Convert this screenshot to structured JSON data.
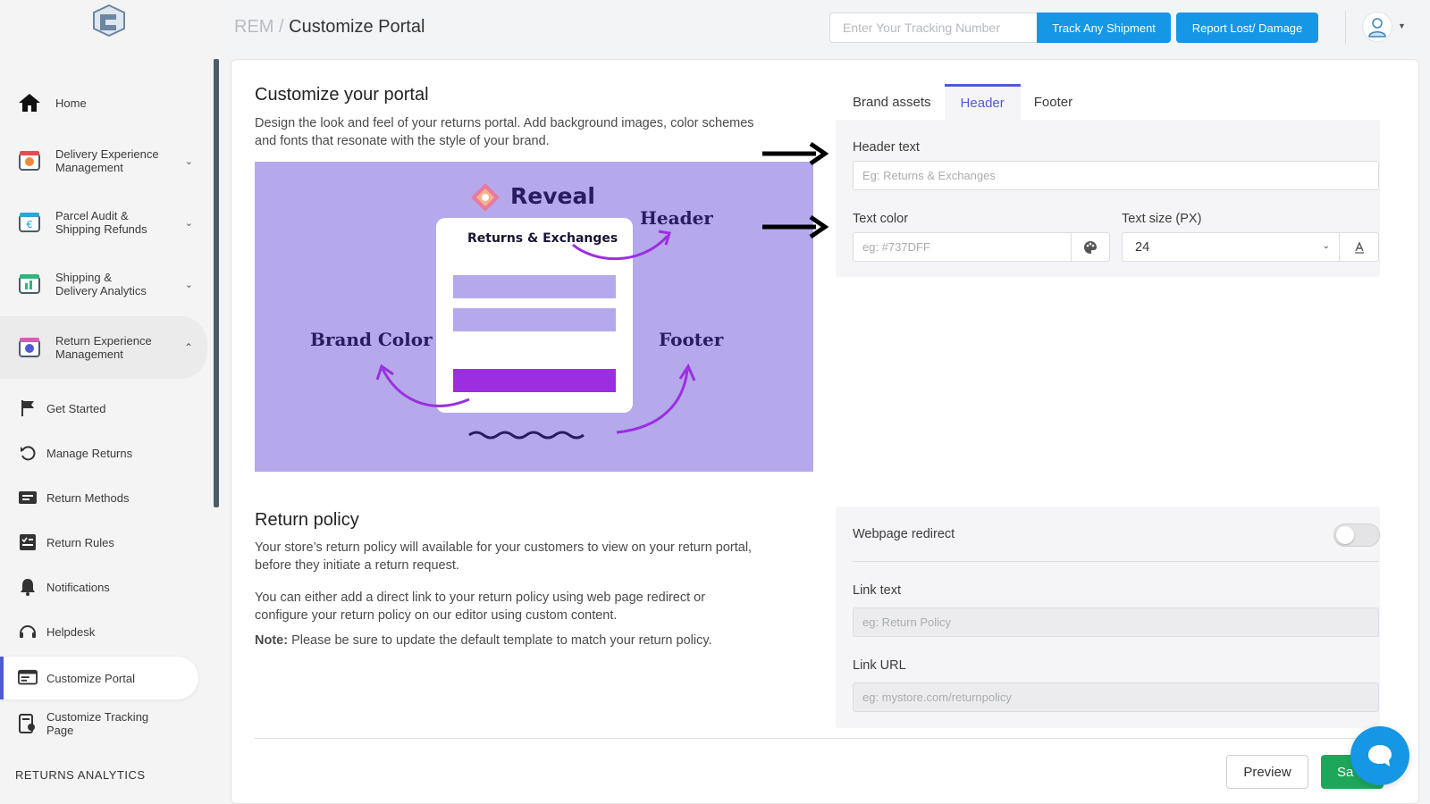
{
  "sidebar": {
    "home": "Home",
    "groups": [
      {
        "label": "Delivery Experience Management",
        "line1": "Delivery Experience",
        "line2": "Management",
        "icon": "delivery-icon"
      },
      {
        "label": "Parcel Audit & Shipping Refunds",
        "line1": "Parcel Audit &",
        "line2": "Shipping Refunds",
        "icon": "parcel-audit-icon"
      },
      {
        "label": "Shipping & Delivery Analytics",
        "line1": "Shipping &",
        "line2": "Delivery Analytics",
        "icon": "analytics-icon"
      },
      {
        "label": "Return Experience Management",
        "line1": "Return Experience",
        "line2": "Management",
        "icon": "return-experience-icon"
      }
    ],
    "sub_items": [
      {
        "label": "Get Started",
        "icon": "flag-icon"
      },
      {
        "label": "Manage Returns",
        "icon": "undo-icon"
      },
      {
        "label": "Return Methods",
        "icon": "return-methods-icon"
      },
      {
        "label": "Return Rules",
        "icon": "checklist-icon"
      },
      {
        "label": "Notifications",
        "icon": "bell-icon"
      },
      {
        "label": "Helpdesk",
        "icon": "headset-icon"
      },
      {
        "label": "Customize Portal",
        "icon": "portal-icon"
      },
      {
        "label": "Customize Tracking Page",
        "line1": "Customize Tracking",
        "line2": "Page",
        "icon": "tracking-page-icon"
      }
    ],
    "section_label": "RETURNS ANALYTICS"
  },
  "topbar": {
    "breadcrumb_root": "REM",
    "breadcrumb_sep": "/",
    "breadcrumb_current": "Customize Portal",
    "tracking_placeholder": "Enter Your Tracking Number",
    "track_button": "Track Any Shipment",
    "report_button": "Report Lost/ Damage"
  },
  "portal": {
    "title": "Customize your portal",
    "description_line1": "Design the look and feel of your returns portal. Add background images, color schemes",
    "description_line2": "and fonts that resonate with the style of your brand.",
    "illustration": {
      "brand": "Reveal",
      "card_title": "Returns & Exchanges",
      "header": "Header",
      "brand_color": "Brand Color",
      "footer": "Footer"
    },
    "tabs": [
      "Brand assets",
      "Header",
      "Footer"
    ],
    "active_tab": "Header",
    "header_text_label": "Header text",
    "header_text_placeholder": "Eg: Returns & Exchanges",
    "text_color_label": "Text color",
    "text_color_placeholder": "eg: #737DFF",
    "text_size_label": "Text size (PX)",
    "text_size_value": "24"
  },
  "policy": {
    "title": "Return policy",
    "p1_line1": "Your store’s return policy will available for your customers to view on your return portal,",
    "p1_line2": "before they initiate a return request.",
    "p2_line1": "You can either add a direct link to your return policy using web page redirect or",
    "p2_line2": "configure your return policy on our editor using custom content.",
    "note_label": "Note:",
    "note_text": " Please be sure to update the default template to match your return policy.",
    "redirect_label": "Webpage redirect",
    "redirect_on": false,
    "link_text_label": "Link text",
    "link_text_placeholder": "eg: Return Policy",
    "link_url_label": "Link URL",
    "link_url_placeholder": "eg: mystore.com/returnpolicy"
  },
  "footer_actions": {
    "preview": "Preview",
    "save": "Sa"
  },
  "colors": {
    "accent": "#4f5bd5",
    "primary_button": "#1597e5",
    "save": "#1ea65a",
    "illustration_bg": "#b5a9ec",
    "illustration_purple": "#9b2fe0",
    "illustration_text": "#2a1c5e"
  }
}
